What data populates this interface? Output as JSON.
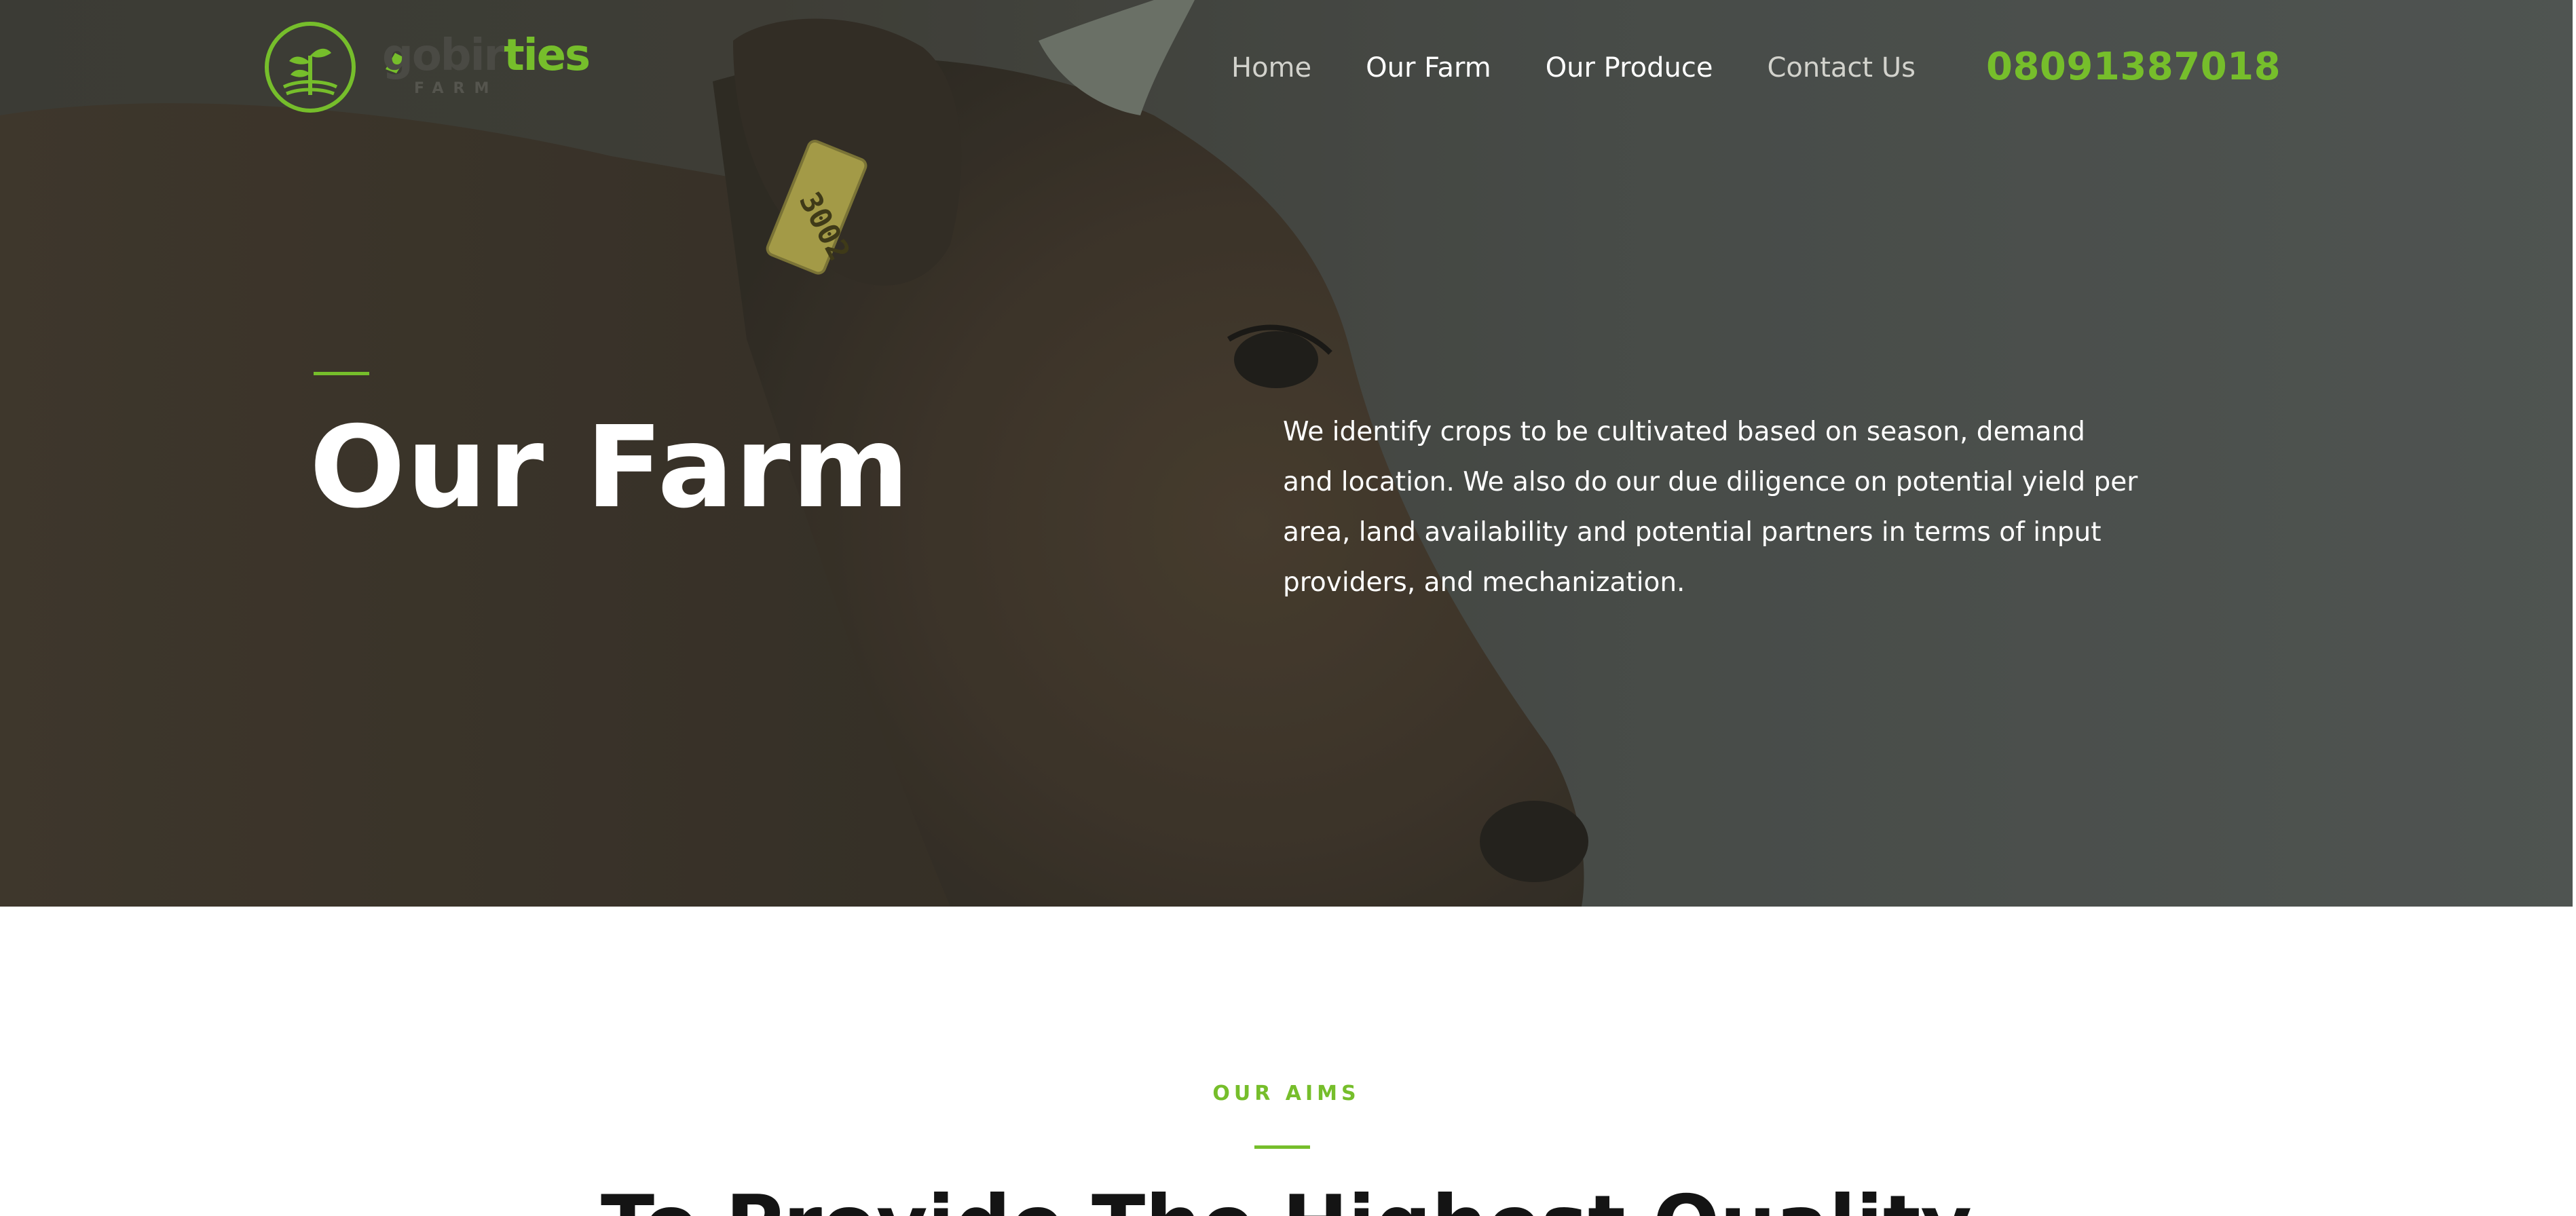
{
  "header": {
    "logo": {
      "text_dim": "gobir",
      "text_green": "ties",
      "sub": "FARM"
    },
    "nav": [
      {
        "label": "Home",
        "style": "muted"
      },
      {
        "label": "Our Farm",
        "style": "bright"
      },
      {
        "label": "Our Produce",
        "style": "bright"
      },
      {
        "label": "Contact Us",
        "style": "muted"
      }
    ],
    "phone": "08091387018"
  },
  "hero": {
    "title": "Our Farm",
    "intro": "We identify crops to be cultivated based on season, demand and location. We also do our due diligence on potential yield per area, land availability and potential partners in terms of input providers, and mechanization.",
    "ear_tag": "3002"
  },
  "aims": {
    "label": "OUR AIMS",
    "heading": "To Provide The Highest Quality"
  },
  "colors": {
    "accent": "#76be2b",
    "text_dark": "#141414",
    "hero_overlay": "#4b4f4d"
  }
}
